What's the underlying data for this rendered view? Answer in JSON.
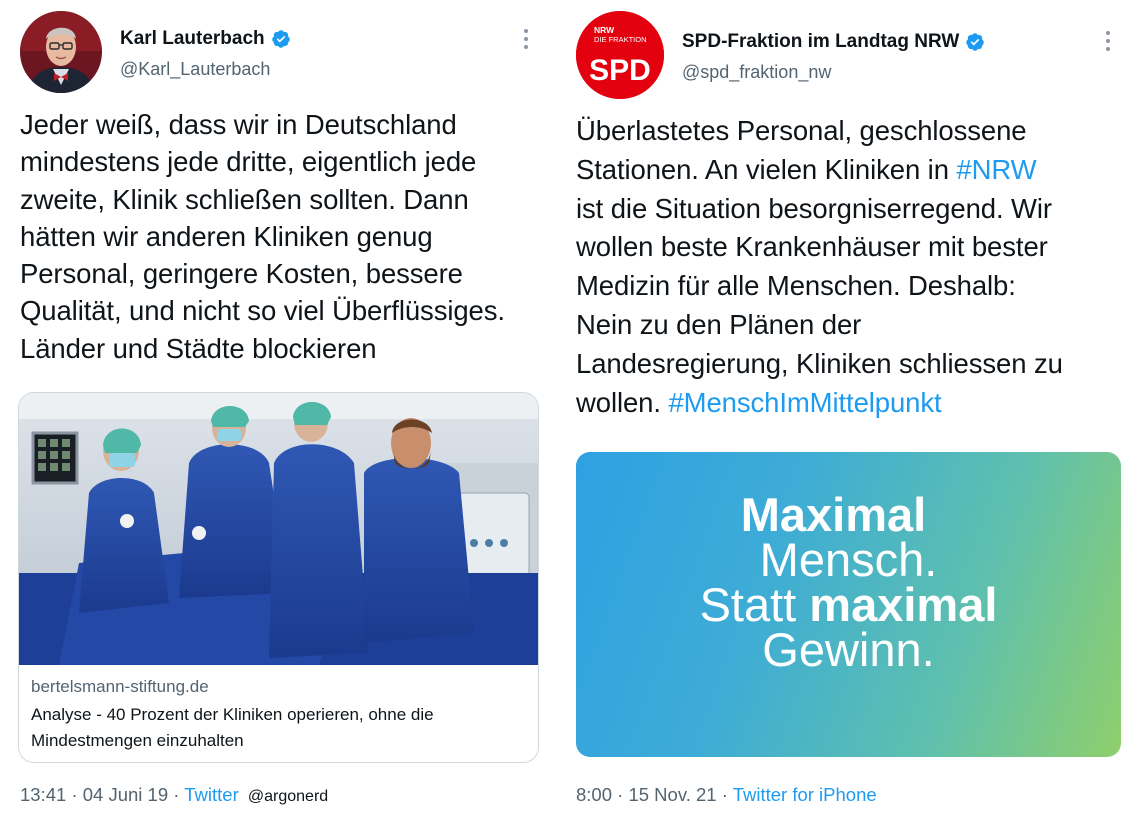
{
  "tweets": [
    {
      "author": {
        "name": "Karl Lauterbach",
        "handle": "@Karl_Lauterbach",
        "verified": true
      },
      "text": "Jeder weiß, dass wir in Deutschland\nmindestens jede dritte, eigentlich jede\nzweite, Klinik schließen sollten. Dann\nhätten wir anderen Kliniken genug\nPersonal, geringere Kosten, bessere\nQualität, und nicht so viel Überflüssiges.\nLänder und Städte blockieren",
      "link_card": {
        "domain": "bertelsmann-stiftung.de",
        "title": "Analyse - 40 Prozent der Kliniken operieren, ohne die\nMindestmengen einzuhalten"
      },
      "footer": {
        "time": "13:41",
        "separator": "·",
        "date": "04 Juni 19",
        "source": "Twitter",
        "credit": "@argonerd"
      }
    },
    {
      "author": {
        "name": "SPD-Fraktion im Landtag NRW",
        "handle": "@spd_fraktion_nw",
        "verified": true,
        "logo": {
          "small_text_1": "NRW",
          "small_text_2": "DIE FRAKTION",
          "big_text": "SPD"
        }
      },
      "text_parts": [
        "Überlastetes Personal, geschlossene\nStationen. An vielen Kliniken in ",
        "#NRW",
        "\nist die Situation besorgniserregend. Wir\nwollen beste Krankenhäuser mit bester\nMedizin für alle Menschen. Deshalb:\nNein zu den Plänen der\nLandesregierung, Kliniken schliessen zu\nwollen. ",
        "#MenschImMittelpunkt"
      ],
      "image": {
        "line1": "Maximal",
        "line2": "Mensch.",
        "line3_a": "Statt ",
        "line3_b": "maximal",
        "line4": "Gewinn."
      },
      "footer": {
        "time": "8:00",
        "separator": "·",
        "date": "15 Nov. 21",
        "source": "Twitter for iPhone"
      }
    }
  ],
  "colors": {
    "link": "#1d9bf0",
    "text": "#0f1419",
    "secondary": "#536471",
    "spd_red": "#e3000f"
  },
  "icons": [
    "verified-badge-icon",
    "more-options-icon"
  ]
}
